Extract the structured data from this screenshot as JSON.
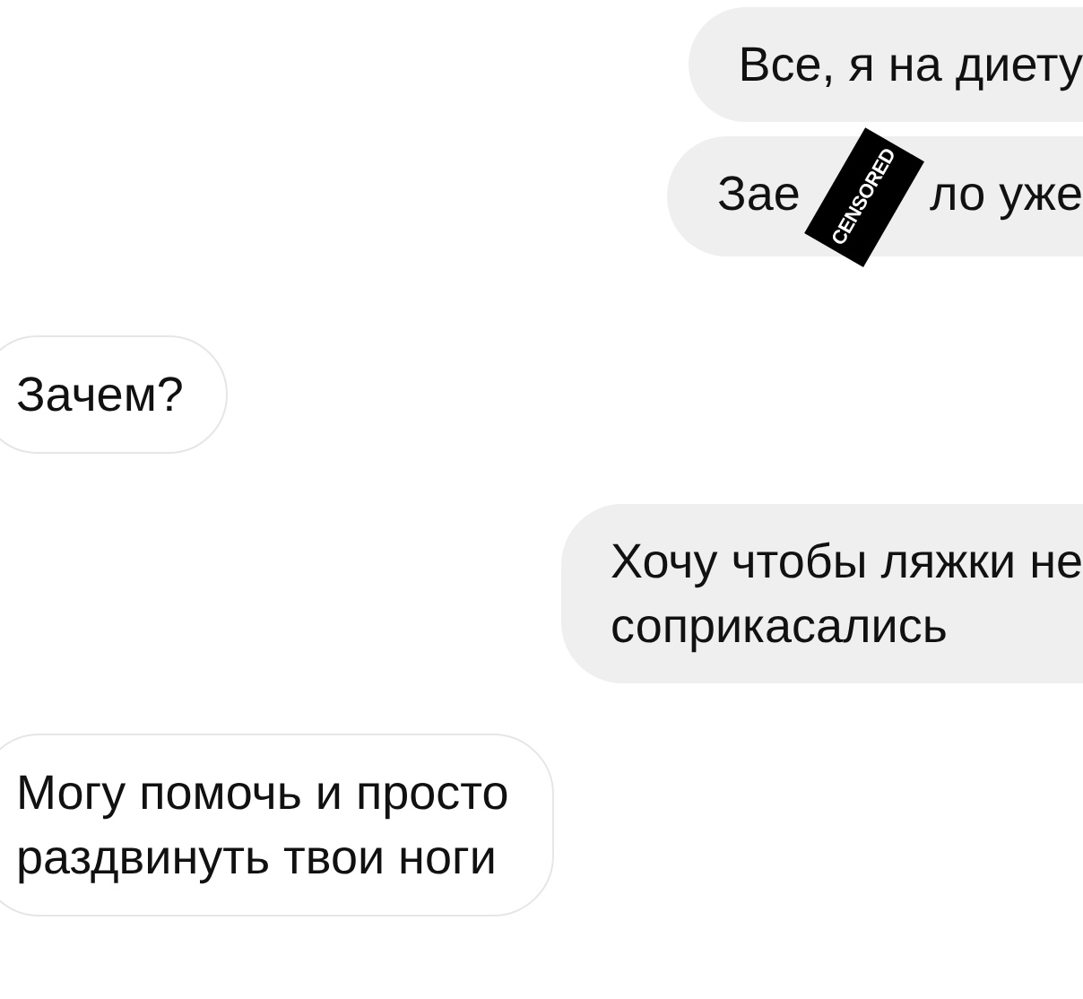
{
  "messages": [
    {
      "kind": "sent",
      "lines": [
        "Все, я на диету"
      ]
    },
    {
      "kind": "sent",
      "lines": [
        "Зае",
        "ло уже"
      ],
      "sticker": "CENSORED"
    },
    {
      "kind": "received",
      "lines": [
        "Зачем?"
      ]
    },
    {
      "kind": "sent",
      "lines": [
        "Хочу чтобы ляжки не",
        "соприкасались"
      ]
    },
    {
      "kind": "received",
      "lines": [
        "Могу помочь и просто",
        "раздвинуть твои ноги"
      ]
    }
  ]
}
